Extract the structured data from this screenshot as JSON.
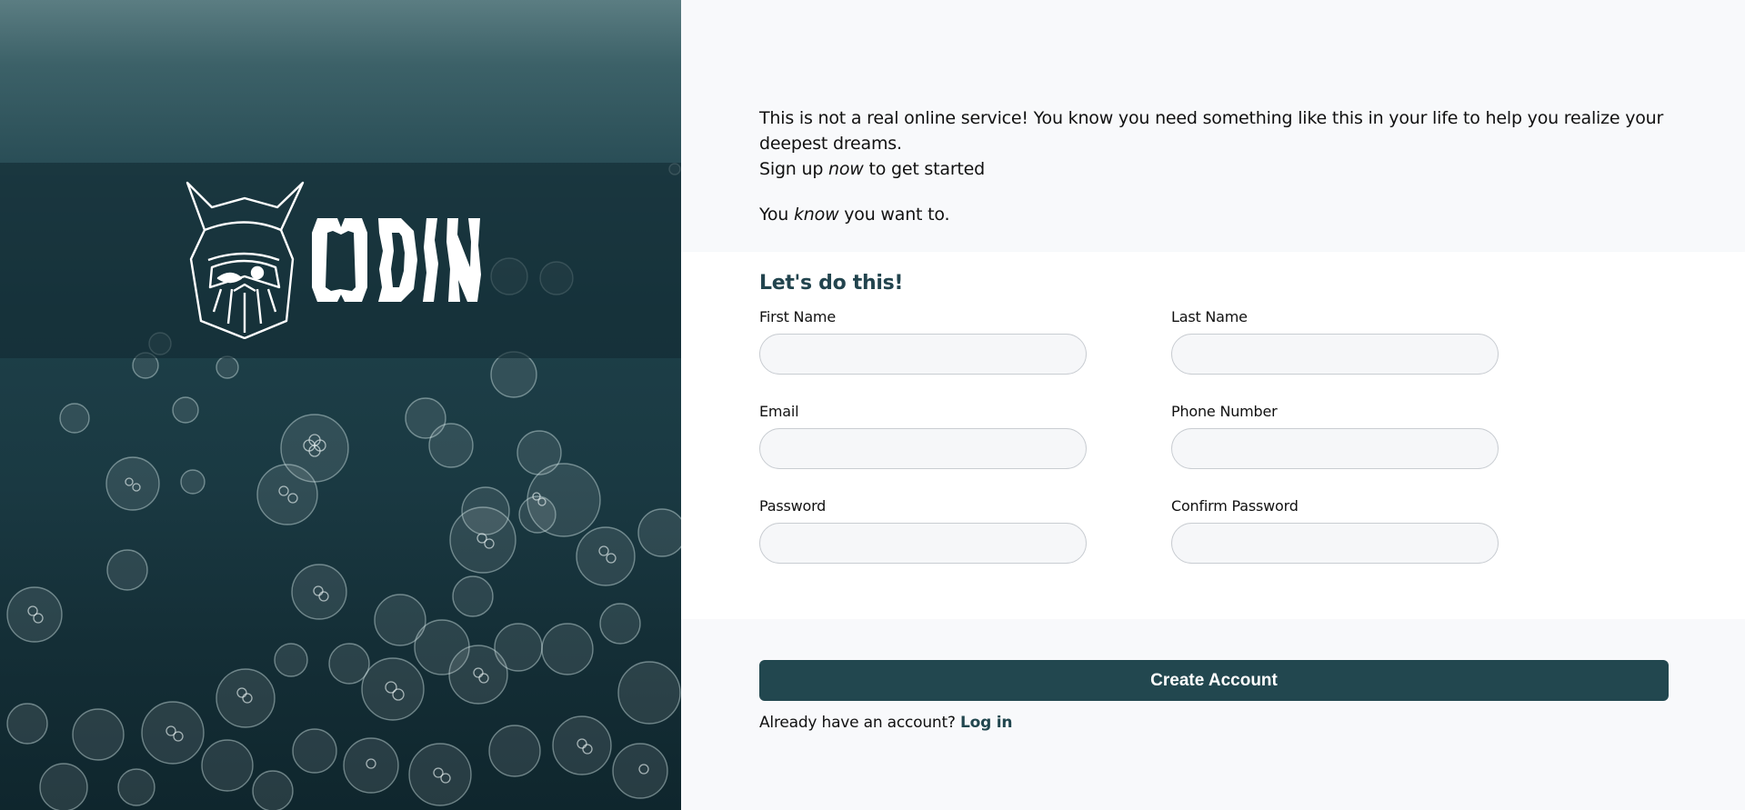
{
  "brand": {
    "name": "ODIN",
    "logo_icon": "viking-helmet-icon",
    "background": "jellyfish-underwater-photo"
  },
  "intro": {
    "line1": "This is not a real online service! You know you need something like this in your life to help you realize your deepest dreams.",
    "line2_prefix": "Sign up ",
    "line2_emphasis": "now",
    "line2_suffix": " to get started",
    "line3_prefix": "You ",
    "line3_emphasis": "know",
    "line3_suffix": " you want to."
  },
  "form": {
    "title": "Let's do this!",
    "fields": {
      "first_name": {
        "label": "First Name",
        "value": ""
      },
      "last_name": {
        "label": "Last Name",
        "value": ""
      },
      "email": {
        "label": "Email",
        "value": ""
      },
      "phone": {
        "label": "Phone Number",
        "value": ""
      },
      "password": {
        "label": "Password",
        "value": ""
      },
      "confirm_password": {
        "label": "Confirm Password",
        "value": ""
      }
    }
  },
  "actions": {
    "create_label": "Create Account",
    "login_prompt": "Already have an account?",
    "login_link": "Log in"
  },
  "colors": {
    "accent": "#22474f",
    "title": "#22444e",
    "page_bg": "#f8f9fb",
    "card_bg": "#ffffff"
  }
}
